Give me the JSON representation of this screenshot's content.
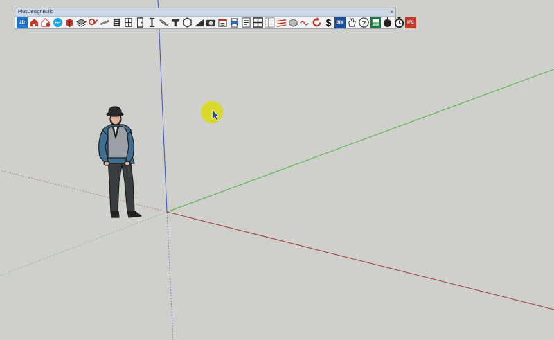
{
  "toolbar": {
    "title": "PlusDesignBuild",
    "close_label": "×",
    "tools": [
      {
        "name": "2d-plans-tool",
        "icon": "2d-badge-icon",
        "label": "2D",
        "color": "#1e73c8"
      },
      {
        "name": "house-tool",
        "icon": "house-icon",
        "color": "#c0392b"
      },
      {
        "name": "house-settings-tool",
        "icon": "house-gear-icon",
        "color": "#c0392b"
      },
      {
        "name": "more-tool",
        "icon": "more-dots-icon",
        "color": "#1fa3d8"
      },
      {
        "name": "box-tool",
        "icon": "red-box-icon",
        "color": "#c0392b"
      },
      {
        "name": "layers-tool",
        "icon": "layers-icon",
        "color": "#333333"
      },
      {
        "name": "ground-tool",
        "icon": "terrain-icon",
        "color": "#c0392b"
      },
      {
        "name": "plank-tool",
        "icon": "plank-icon",
        "color": "#555555"
      },
      {
        "name": "stairs-tool",
        "icon": "stairs-icon",
        "color": "#333333"
      },
      {
        "name": "window-tool",
        "icon": "window-icon",
        "color": "#333333"
      },
      {
        "name": "door-tool",
        "icon": "door-icon",
        "color": "#333333"
      },
      {
        "name": "column-tool",
        "icon": "i-beam-icon",
        "color": "#333333"
      },
      {
        "name": "rafter-tool",
        "icon": "rafter-icon",
        "color": "#333333"
      },
      {
        "name": "angle-profile-tool",
        "icon": "angle-profile-icon",
        "color": "#333333"
      },
      {
        "name": "hexagon-tool",
        "icon": "hexagon-icon",
        "color": "#333333"
      },
      {
        "name": "slope-tool",
        "icon": "slope-icon",
        "color": "#333333"
      },
      {
        "name": "camera-tool",
        "icon": "camera-icon",
        "color": "#333333"
      },
      {
        "name": "schedule-tool",
        "icon": "calendar-icon",
        "color": "#c0392b"
      },
      {
        "name": "print-tool",
        "icon": "printer-icon",
        "color": "#1e73c8"
      },
      {
        "name": "sheet-tool",
        "icon": "sheet-icon",
        "color": "#333333"
      },
      {
        "name": "grid-tool",
        "icon": "grid-icon",
        "color": "#222222"
      },
      {
        "name": "light-grid-tool",
        "icon": "light-grid-icon",
        "color": "#888888"
      },
      {
        "name": "rebar-tool",
        "icon": "rebar-icon",
        "color": "#c0392b"
      },
      {
        "name": "brick-tool",
        "icon": "brick-icon",
        "color": "#555555"
      },
      {
        "name": "wave-tool",
        "icon": "wave-icon",
        "color": "#c0392b"
      },
      {
        "name": "refresh-tool",
        "icon": "refresh-icon",
        "color": "#c0392b"
      },
      {
        "name": "cost-tool",
        "icon": "dollar-icon",
        "color": "#111111"
      },
      {
        "name": "bim-tool",
        "icon": "bim-badge-icon",
        "label": "BIM",
        "color": "#1e4f9c"
      },
      {
        "name": "hand-tool",
        "icon": "hand-icon",
        "color": "#333333"
      },
      {
        "name": "help-tool",
        "icon": "help-icon",
        "color": "#333333"
      },
      {
        "name": "share-tool",
        "icon": "share-badge-icon",
        "color": "#1a7a3a"
      },
      {
        "name": "finish-tool",
        "icon": "flag-icon",
        "color": "#c0392b"
      },
      {
        "name": "timer-tool",
        "icon": "timer-icon",
        "color": "#222222"
      },
      {
        "name": "ifc-tool",
        "icon": "ifc-badge-icon",
        "label": "IFC",
        "color": "#c0392b"
      }
    ]
  },
  "scene": {
    "background": "#cfd0cb",
    "axis_colors": {
      "blue": "#3b4fc4",
      "green": "#4ab43e",
      "red": "#a23b3b"
    },
    "cursor_highlight": "#dada12",
    "figure": {
      "jacket": "#3f6f92",
      "vest": "#9aa0a6",
      "trousers": "#3a3d40",
      "skin": "#e0b49a",
      "hat": "#2a2a2a"
    }
  }
}
